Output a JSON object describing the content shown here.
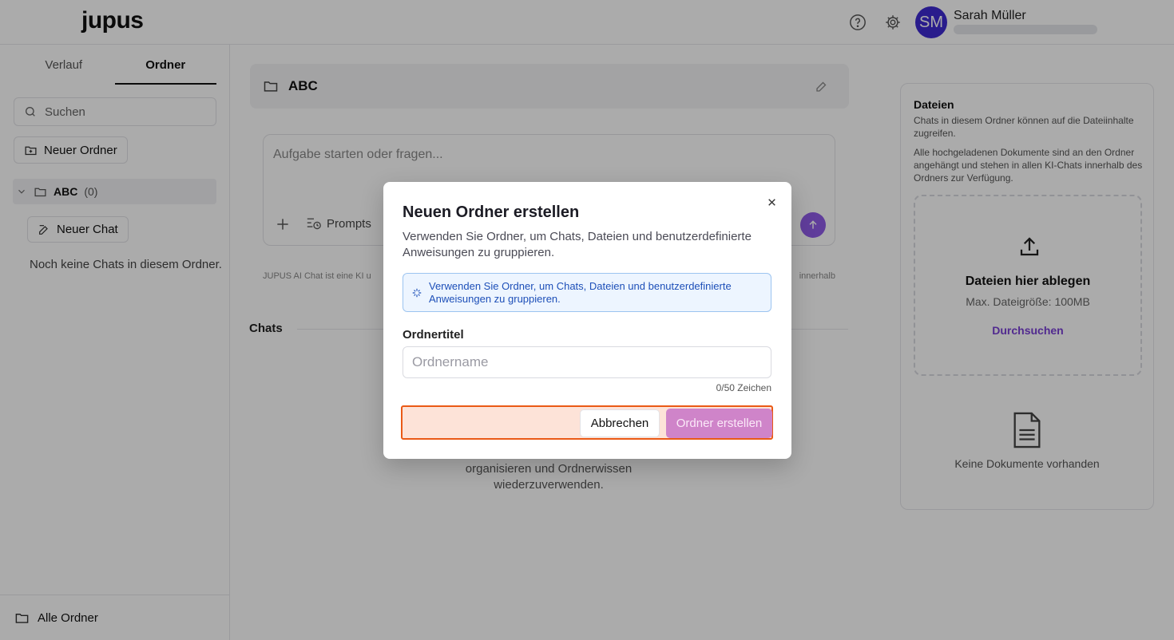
{
  "app": {
    "logo": "jupus",
    "user_name": "Sarah Müller",
    "user_initials": "SM",
    "accent_color": "#3e2ad1"
  },
  "sidebar": {
    "tabs": [
      {
        "label": "Verlauf",
        "active": false
      },
      {
        "label": "Ordner",
        "active": true
      }
    ],
    "search_placeholder": "Suchen",
    "new_folder_label": "Neuer Ordner",
    "folder": {
      "name": "ABC",
      "count": "(0)"
    },
    "new_chat_label": "Neuer Chat",
    "empty_note": "Noch keine Chats in diesem Ordner.",
    "all_folders_label": "Alle Ordner"
  },
  "main": {
    "folder_title": "ABC",
    "composer_placeholder": "Aufgabe starten oder fragen...",
    "prompts_label": "Prompts",
    "disclaimer_left": "JUPUS AI Chat ist eine KI u",
    "disclaimer_right": "innerhalb",
    "chats_label": "Chats",
    "empty_chats_text": "organisieren und Ordnerwissen wiederzuverwenden."
  },
  "files": {
    "title": "Dateien",
    "desc1": "Chats in diesem Ordner können auf die Dateiinhalte zugreifen.",
    "desc2": "Alle hochgeladenen Dokumente sind an den Ordner angehängt und stehen in allen KI-Chats innerhalb des Ordners zur Verfügung.",
    "drop_title": "Dateien hier ablegen",
    "max_size": "Max. Dateigröße: 100MB",
    "browse": "Durchsuchen",
    "no_docs": "Keine Dokumente vorhanden"
  },
  "modal": {
    "title": "Neuen Ordner erstellen",
    "description": "Verwenden Sie Ordner, um Chats, Dateien und benutzerdefinierte Anweisungen zu gruppieren.",
    "info": "Verwenden Sie Ordner, um Chats, Dateien und benutzerdefinierte Anweisungen zu gruppieren.",
    "field_label": "Ordnertitel",
    "input_placeholder": "Ordnername",
    "input_value": "",
    "counter": "0/50 Zeichen",
    "cancel_label": "Abbrechen",
    "create_label": "Ordner erstellen",
    "highlight_color": "#ea5a16"
  }
}
